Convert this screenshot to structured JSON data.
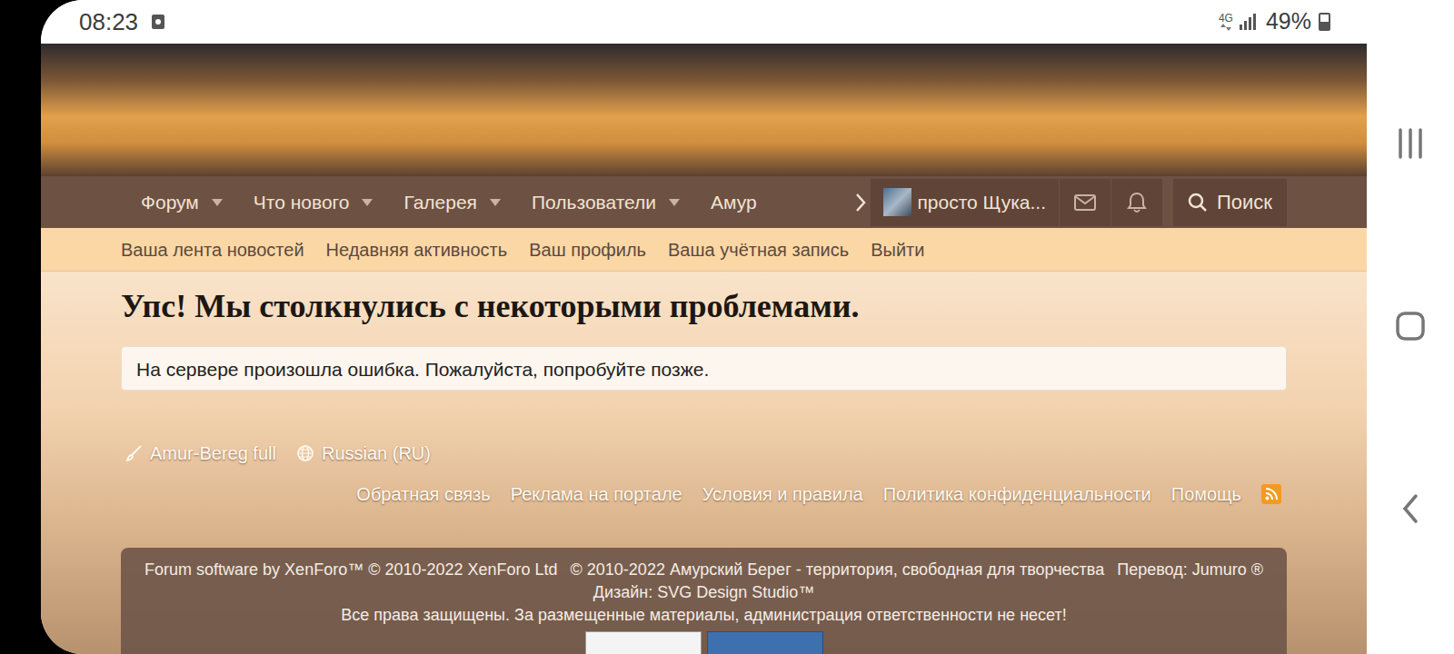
{
  "status_bar": {
    "time": "08:23",
    "network": "4G",
    "battery": "49%",
    "battery_level": 0.49
  },
  "nav": {
    "items": [
      {
        "label": "Форум",
        "dropdown": true
      },
      {
        "label": "Что нового",
        "dropdown": true
      },
      {
        "label": "Галерея",
        "dropdown": true
      },
      {
        "label": "Пользователи",
        "dropdown": true
      },
      {
        "label": "Амур",
        "dropdown": false
      }
    ],
    "user": "просто Щука...",
    "search": "Поиск"
  },
  "subnav": [
    "Ваша лента новостей",
    "Недавняя активность",
    "Ваш профиль",
    "Ваша учётная запись",
    "Выйти"
  ],
  "error": {
    "title": "Упс! Мы столкнулись с некоторыми проблемами.",
    "message": "На сервере произошла ошибка. Пожалуйста, попробуйте позже."
  },
  "footer": {
    "style": "Amur-Bereg full",
    "language": "Russian (RU)",
    "links": [
      "Обратная связь",
      "Реклама на портале",
      "Условия и правила",
      "Политика конфиденциальности",
      "Помощь"
    ],
    "copyright": [
      [
        "Forum software by XenForo™ © 2010-2022 XenForo Ltd",
        "© 2010-2022 Амурский Берег - территория, свободная для творчества",
        "Перевод: Jumuro ®"
      ],
      [
        "Дизайн: SVG Design Studio™"
      ],
      [
        "Все права защищены. За размещенные материалы, администрация ответственности не несет!"
      ]
    ]
  }
}
